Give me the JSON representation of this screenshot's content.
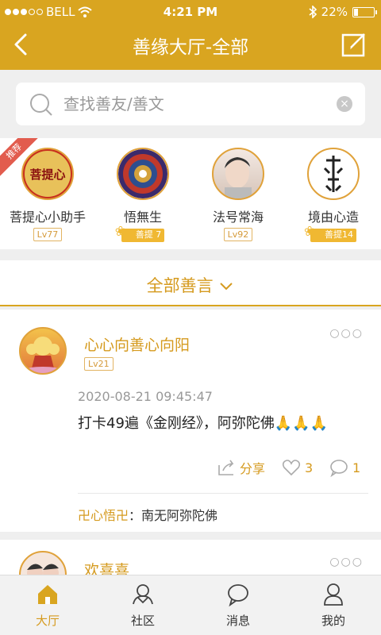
{
  "status": {
    "carrier": "BELL",
    "time": "4:21 PM",
    "battery": "22%",
    "battery_level": 0.22
  },
  "nav": {
    "title": "善缘大厅-全部"
  },
  "search": {
    "placeholder": "查找善友/善文"
  },
  "recommend": {
    "tag": "推荐",
    "users": [
      {
        "name": "菩提心小助手",
        "badge": "Lv77",
        "badge_type": "level",
        "avatar_text": "菩提心"
      },
      {
        "name": "悟無生",
        "badge": "善提 7",
        "badge_type": "puti"
      },
      {
        "name": "法号常海",
        "badge": "Lv92",
        "badge_type": "level"
      },
      {
        "name": "境由心造",
        "badge": "善提14",
        "badge_type": "puti"
      }
    ]
  },
  "filter": {
    "label": "全部善言"
  },
  "posts": [
    {
      "author": "心心向善心向阳",
      "level": "Lv21",
      "time": "2020-08-21 09:45:47",
      "text": "打卡49遍《金刚经》，阿弥陀佛",
      "emoji": "🙏🙏🙏",
      "share_label": "分享",
      "likes": "3",
      "comments": "1",
      "comment_author": "卍心悟卍",
      "comment_text": "南无阿弥陀佛"
    },
    {
      "author": "欢喜喜"
    }
  ],
  "tabs": [
    {
      "label": "大厅",
      "icon": "home-icon",
      "active": true
    },
    {
      "label": "社区",
      "icon": "community-icon",
      "active": false
    },
    {
      "label": "消息",
      "icon": "message-icon",
      "active": false
    },
    {
      "label": "我的",
      "icon": "profile-icon",
      "active": false
    }
  ],
  "colors": {
    "brand": "#d9a520",
    "accent_text": "#d59a1e"
  }
}
